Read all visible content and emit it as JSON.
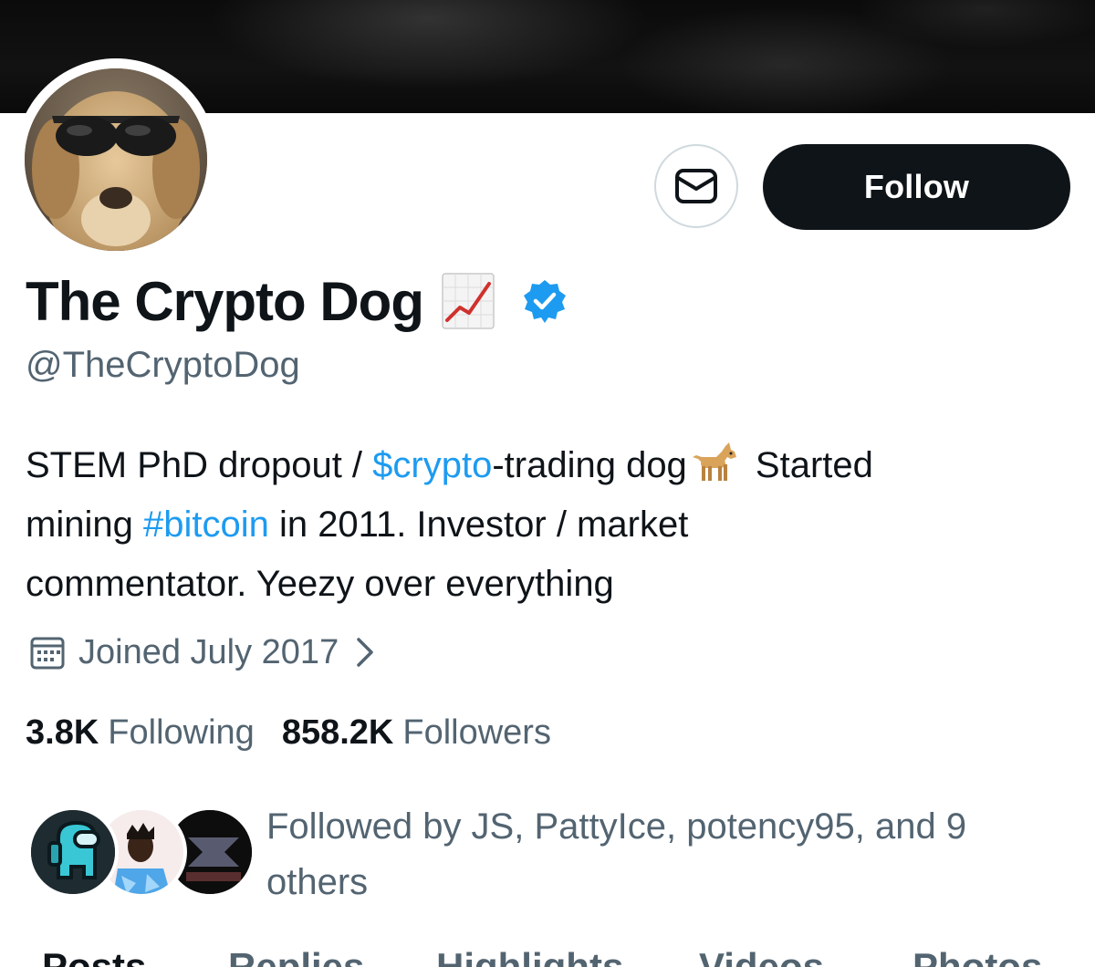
{
  "profile": {
    "display_name": "The Crypto Dog",
    "handle": "@TheCryptoDog",
    "bio_parts": {
      "p1": "STEM PhD dropout / ",
      "cashtag": "$crypto",
      "p2": "-trading dog",
      "p3": " Started",
      "p4": "mining ",
      "hashtag": "#bitcoin",
      "p5": " in 2011. Investor / market",
      "p6": "commentator. Yeezy over everything"
    },
    "joined": "Joined July 2017",
    "following_count": "3.8K",
    "following_label": "Following",
    "followers_count": "858.2K",
    "followers_label": "Followers",
    "followed_by": "Followed by JS, PattyIce, potency95, and 9 others"
  },
  "actions": {
    "follow_label": "Follow"
  },
  "tabs": [
    {
      "label": "Posts"
    },
    {
      "label": "Replies"
    },
    {
      "label": "Highlights"
    },
    {
      "label": "Videos"
    },
    {
      "label": "Photos"
    }
  ],
  "icons": {
    "message": "envelope-icon",
    "verified": "verified-badge-icon",
    "calendar": "calendar-icon",
    "chevron": "chevron-right-icon",
    "chart": "chart-increasing-emoji",
    "dog": "dog-emoji"
  },
  "colors": {
    "link": "#1d9bf0",
    "secondary_text": "#536471",
    "primary_text": "#0f1419",
    "follow_button_bg": "#0f1419",
    "verified": "#1d9bf0"
  }
}
